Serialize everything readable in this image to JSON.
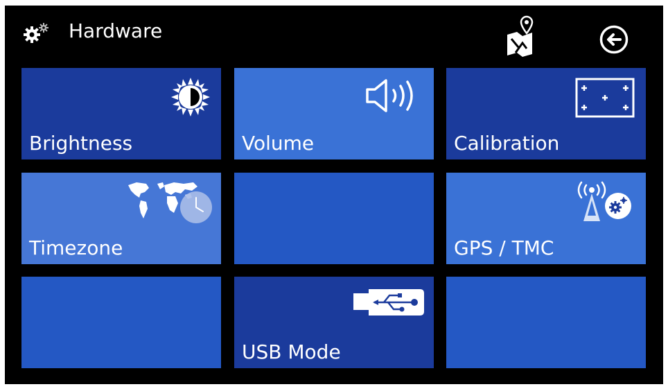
{
  "header": {
    "title": "Hardware",
    "title_icon": "gear-icon",
    "map_icon": "map-marker-icon",
    "back_icon": "back-arrow-icon"
  },
  "colors": {
    "background": "#000000",
    "tile_dark": "#1B3B9C",
    "tile_medium": "#2458C4",
    "tile_light": "#3A72D6",
    "tile_lighter": "#4677D6",
    "text": "#FFFFFF"
  },
  "tiles": [
    {
      "label": "Brightness",
      "icon": "brightness-icon"
    },
    {
      "label": "Volume",
      "icon": "speaker-icon"
    },
    {
      "label": "Calibration",
      "icon": "calibration-icon"
    },
    {
      "label": "Timezone",
      "icon": "world-clock-icon"
    },
    {
      "label": "",
      "icon": ""
    },
    {
      "label": "GPS / TMC",
      "icon": "antenna-settings-icon"
    },
    {
      "label": "",
      "icon": ""
    },
    {
      "label": "USB Mode",
      "icon": "usb-icon"
    },
    {
      "label": "",
      "icon": ""
    }
  ]
}
